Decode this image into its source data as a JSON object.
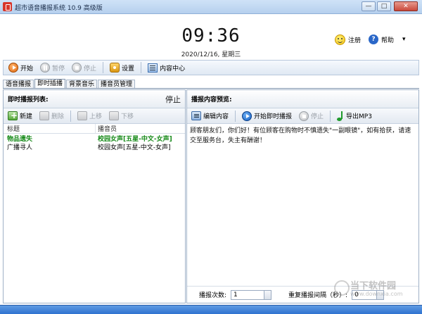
{
  "window": {
    "title": "超市语音播报系统 10.9 高级版",
    "controls": [
      "—",
      "□",
      "✕"
    ]
  },
  "clock": {
    "time": "09:36",
    "date": "2020/12/16, 星期三"
  },
  "topright": {
    "register": "注册",
    "help": "帮助",
    "help_glyph": "?",
    "dropdown": "▾"
  },
  "toolbar": {
    "start": "开始",
    "pause": "暂停",
    "stop": "停止",
    "settings": "设置",
    "content_center": "内容中心"
  },
  "tabs": [
    "语音播报",
    "即时插播",
    "背景音乐",
    "播音员管理"
  ],
  "left_panel": {
    "title": "即时播报列表:",
    "status": "停止",
    "tools": {
      "new": "新建",
      "delete": "删除",
      "up": "上移",
      "down": "下移"
    },
    "columns": [
      "标题",
      "播音员"
    ],
    "rows": [
      {
        "title": "物品遗失",
        "announcer": "校园女声[五星-中文-女声]"
      },
      {
        "title": "广播寻人",
        "announcer": "校园女声[五星-中文-女声]"
      }
    ]
  },
  "right_panel": {
    "title": "播报内容预览:",
    "tools": {
      "edit": "编辑内容",
      "start": "开始即时播报",
      "stop": "停止",
      "export": "导出MP3"
    },
    "preview": "顾客朋友们，你们好！有位顾客在购物时不慎遗失\"一副眼镜\"，如有拾获，请速交至服务台，失主有酬谢！",
    "count_label": "播报次数:",
    "count_value": "1",
    "interval_label": "重复播报间隔（秒）:",
    "interval_value": "0"
  },
  "watermark": {
    "name": "当下软件园",
    "url": "www.downxia.com"
  }
}
